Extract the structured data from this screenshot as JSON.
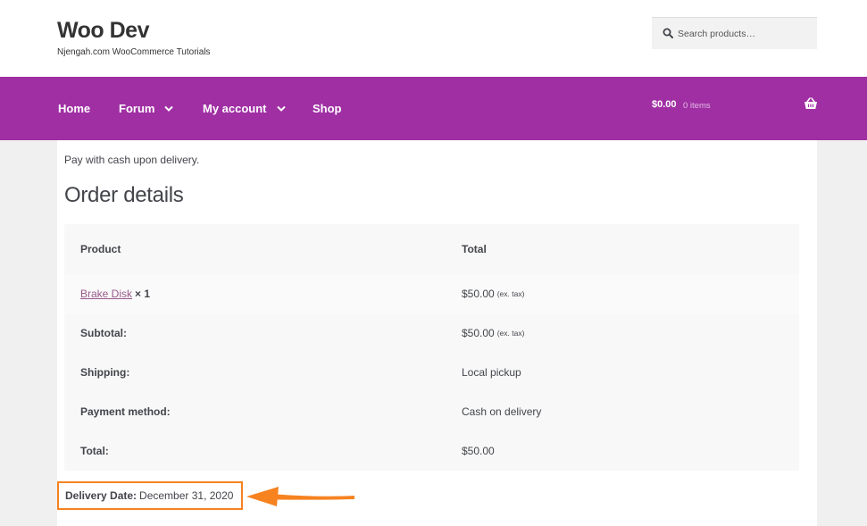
{
  "header": {
    "site_title": "Woo Dev",
    "tagline": "Njengah.com WooCommerce Tutorials",
    "search_placeholder": "Search products…"
  },
  "nav": {
    "items": [
      {
        "label": "Home",
        "has_dropdown": false
      },
      {
        "label": "Forum",
        "has_dropdown": true
      },
      {
        "label": "My account",
        "has_dropdown": true
      },
      {
        "label": "Shop",
        "has_dropdown": false
      }
    ],
    "cart_amount": "$0.00",
    "cart_items": "0 items"
  },
  "content": {
    "payment_note": "Pay with cash upon delivery.",
    "heading": "Order details",
    "table": {
      "header": {
        "product": "Product",
        "total": "Total"
      },
      "item": {
        "name": "Brake Disk",
        "qty": "× 1",
        "price": "$50.00",
        "tax_note": "(ex. tax)"
      },
      "subtotal": {
        "label": "Subtotal:",
        "value": "$50.00",
        "tax_note": "(ex. tax)"
      },
      "shipping": {
        "label": "Shipping:",
        "value": "Local pickup"
      },
      "payment_method": {
        "label": "Payment method:",
        "value": "Cash on delivery"
      },
      "total": {
        "label": "Total:",
        "value": "$50.00"
      }
    },
    "delivery": {
      "label": "Delivery Date:",
      "value": "December 31, 2020"
    }
  },
  "colors": {
    "nav_bg": "#a02fa4",
    "highlight": "#f68220",
    "link": "#96588a"
  },
  "icons": [
    "search-icon",
    "chevron-down-icon",
    "basket-icon",
    "arrow-icon"
  ]
}
